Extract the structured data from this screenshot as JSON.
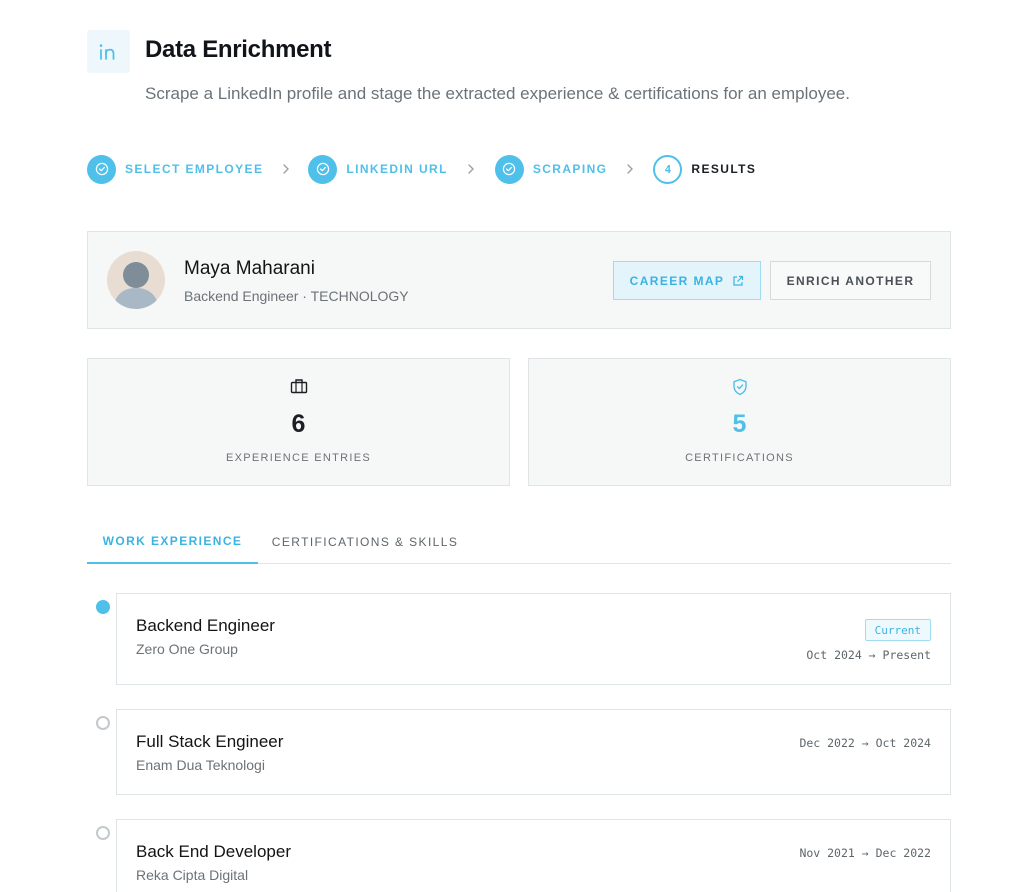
{
  "header": {
    "logo_icon": "linkedin-icon",
    "title": "Data Enrichment",
    "subtitle": "Scrape a LinkedIn profile and stage the extracted experience & certifications for an employee."
  },
  "stepper": {
    "steps": [
      {
        "label": "SELECT EMPLOYEE",
        "status": "done"
      },
      {
        "label": "LINKEDIN URL",
        "status": "done"
      },
      {
        "label": "SCRAPING",
        "status": "done"
      },
      {
        "label": "RESULTS",
        "status": "active",
        "number": "4"
      }
    ]
  },
  "profile": {
    "name": "Maya Maharani",
    "meta": "Backend Engineer · TECHNOLOGY",
    "career_map_label": "CAREER MAP",
    "enrich_another_label": "ENRICH ANOTHER"
  },
  "stats": {
    "experience": {
      "value": "6",
      "label": "EXPERIENCE ENTRIES",
      "icon": "briefcase-icon"
    },
    "certifications": {
      "value": "5",
      "label": "CERTIFICATIONS",
      "icon": "shield-check-icon"
    }
  },
  "tabs": [
    {
      "label": "WORK EXPERIENCE",
      "active": true
    },
    {
      "label": "CERTIFICATIONS & SKILLS",
      "active": false
    }
  ],
  "experience": [
    {
      "title": "Backend Engineer",
      "company": "Zero One Group",
      "dates": "Oct 2024 → Present",
      "badge": "Current"
    },
    {
      "title": "Full Stack Engineer",
      "company": "Enam Dua Teknologi",
      "dates": "Dec 2022 → Oct 2024"
    },
    {
      "title": "Back End Developer",
      "company": "Reka Cipta Digital",
      "dates": "Nov 2021 → Dec 2022"
    }
  ],
  "colors": {
    "accent": "#4fc0ea",
    "card_bg": "#f6f8f8",
    "border": "#dfe4e6"
  }
}
